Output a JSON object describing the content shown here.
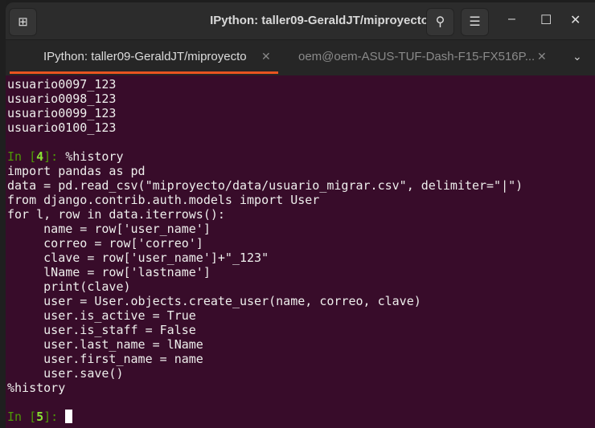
{
  "window": {
    "title": "IPython: taller09-GeraldJT/miproyecto"
  },
  "tabs": [
    {
      "label": "IPython: taller09-GeraldJT/miproyecto",
      "active": true
    },
    {
      "label": "oem@oem-ASUS-TUF-Dash-F15-FX516P...",
      "active": false
    }
  ],
  "terminal": {
    "output_lines": [
      "usuario0097_123",
      "usuario0098_123",
      "usuario0099_123",
      "usuario0100_123"
    ],
    "prompt4": {
      "pre": "In [",
      "num": "4",
      "post": "]: ",
      "cmd": "%history"
    },
    "history_lines": [
      "import pandas as pd",
      "data = pd.read_csv(\"miproyecto/data/usuario_migrar.csv\", delimiter=\"|\")",
      "from django.contrib.auth.models import User",
      "for l, row in data.iterrows():",
      "     name = row['user_name']",
      "     correo = row['correo']",
      "     clave = row['user_name']+\"_123\"",
      "     lName = row['lastname']",
      "     print(clave)",
      "     user = User.objects.create_user(name, correo, clave)",
      "     user.is_active = True",
      "     user.is_staff = False",
      "     user.last_name = lName",
      "     user.first_name = name",
      "     user.save()",
      "%history"
    ],
    "prompt5": {
      "pre": "In [",
      "num": "5",
      "post": "]: "
    }
  },
  "colors": {
    "background": "#380c2a",
    "accent": "#e95420"
  }
}
